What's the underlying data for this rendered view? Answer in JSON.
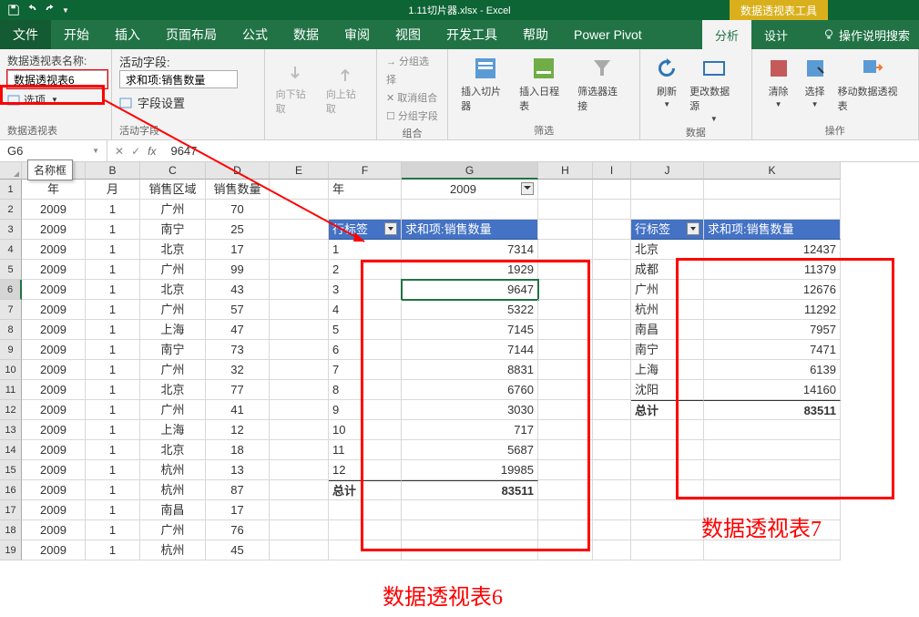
{
  "title": "1.11切片器.xlsx - Excel",
  "context_tool": "数据透视表工具",
  "tabs": {
    "file": "文件",
    "home": "开始",
    "insert": "插入",
    "layout": "页面布局",
    "formulas": "公式",
    "data": "数据",
    "review": "审阅",
    "view": "视图",
    "dev": "开发工具",
    "help": "帮助",
    "power": "Power Pivot",
    "analyze": "分析",
    "design": "设计"
  },
  "tell_me": "操作说明搜索",
  "ribbon": {
    "g1": {
      "title": "数据透视表",
      "name_lbl": "数据透视表名称:",
      "name_val": "数据透视表6",
      "opt": "选项"
    },
    "g2": {
      "title": "活动字段",
      "lbl": "活动字段:",
      "val": "求和项:销售数量",
      "fs": "字段设置",
      "dd": "向下钻取",
      "du": "向上钻取"
    },
    "g3": {
      "title": "组合",
      "a": "分组选择",
      "b": "取消组合",
      "c": "分组字段"
    },
    "g4": {
      "title": "筛选",
      "a": "插入切片器",
      "b": "插入日程表",
      "c": "筛选器连接"
    },
    "g5": {
      "title": "数据",
      "a": "刷新",
      "b": "更改数据源"
    },
    "g6": {
      "title": "操作",
      "a": "清除",
      "b": "选择",
      "c": "移动数据透视表"
    }
  },
  "fb": {
    "name": "G6",
    "val": "9647",
    "tooltip": "名称框"
  },
  "cols": [
    "A",
    "B",
    "C",
    "D",
    "E",
    "F",
    "G",
    "H",
    "I",
    "J",
    "K"
  ],
  "header_row": {
    "A": "年",
    "B": "月",
    "C": "销售区域",
    "D": "销售数量"
  },
  "data": [
    {
      "A": "2009",
      "B": "1",
      "C": "广州",
      "D": "70"
    },
    {
      "A": "2009",
      "B": "1",
      "C": "南宁",
      "D": "25"
    },
    {
      "A": "2009",
      "B": "1",
      "C": "北京",
      "D": "17"
    },
    {
      "A": "2009",
      "B": "1",
      "C": "广州",
      "D": "99"
    },
    {
      "A": "2009",
      "B": "1",
      "C": "北京",
      "D": "43"
    },
    {
      "A": "2009",
      "B": "1",
      "C": "广州",
      "D": "57"
    },
    {
      "A": "2009",
      "B": "1",
      "C": "上海",
      "D": "47"
    },
    {
      "A": "2009",
      "B": "1",
      "C": "南宁",
      "D": "73"
    },
    {
      "A": "2009",
      "B": "1",
      "C": "广州",
      "D": "32"
    },
    {
      "A": "2009",
      "B": "1",
      "C": "北京",
      "D": "77"
    },
    {
      "A": "2009",
      "B": "1",
      "C": "广州",
      "D": "41"
    },
    {
      "A": "2009",
      "B": "1",
      "C": "上海",
      "D": "12"
    },
    {
      "A": "2009",
      "B": "1",
      "C": "北京",
      "D": "18"
    },
    {
      "A": "2009",
      "B": "1",
      "C": "杭州",
      "D": "13"
    },
    {
      "A": "2009",
      "B": "1",
      "C": "杭州",
      "D": "87"
    },
    {
      "A": "2009",
      "B": "1",
      "C": "南昌",
      "D": "17"
    },
    {
      "A": "2009",
      "B": "1",
      "C": "广州",
      "D": "76"
    },
    {
      "A": "2009",
      "B": "1",
      "C": "杭州",
      "D": "45"
    }
  ],
  "pvt6": {
    "filter_lbl": "年",
    "filter_val": "2009",
    "h1": "行标签",
    "h2": "求和项:销售数量",
    "rows": [
      [
        "1",
        "7314"
      ],
      [
        "2",
        "1929"
      ],
      [
        "3",
        "9647"
      ],
      [
        "4",
        "5322"
      ],
      [
        "5",
        "7145"
      ],
      [
        "6",
        "7144"
      ],
      [
        "7",
        "8831"
      ],
      [
        "8",
        "6760"
      ],
      [
        "9",
        "3030"
      ],
      [
        "10",
        "717"
      ],
      [
        "11",
        "5687"
      ],
      [
        "12",
        "19985"
      ]
    ],
    "tot_lbl": "总计",
    "tot_val": "83511"
  },
  "pvt7": {
    "h1": "行标签",
    "h2": "求和项:销售数量",
    "rows": [
      [
        "北京",
        "12437"
      ],
      [
        "成都",
        "11379"
      ],
      [
        "广州",
        "12676"
      ],
      [
        "杭州",
        "11292"
      ],
      [
        "南昌",
        "7957"
      ],
      [
        "南宁",
        "7471"
      ],
      [
        "上海",
        "6139"
      ],
      [
        "沈阳",
        "14160"
      ]
    ],
    "tot_lbl": "总计",
    "tot_val": "83511"
  },
  "anno": {
    "p6": "数据透视表6",
    "p7": "数据透视表7"
  }
}
